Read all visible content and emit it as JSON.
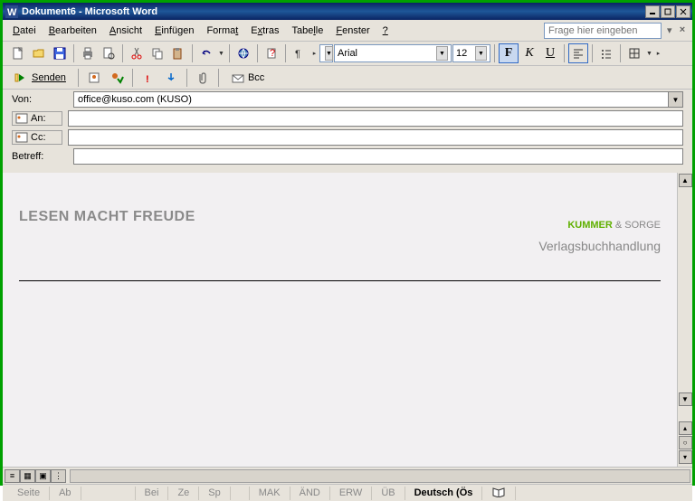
{
  "window": {
    "title": "Dokument6 - Microsoft Word"
  },
  "menu": {
    "items": [
      "Datei",
      "Bearbeiten",
      "Ansicht",
      "Einfügen",
      "Format",
      "Extras",
      "Tabelle",
      "Fenster",
      "?"
    ],
    "helpPlaceholder": "Frage hier eingeben"
  },
  "formatting": {
    "fontName": "Arial",
    "fontSize": "12",
    "bold": "F",
    "italic": "K",
    "underline": "U"
  },
  "email": {
    "sendLabel": "Senden",
    "bccLabel": "Bcc",
    "fields": {
      "von": {
        "label": "Von:",
        "value": "office@kuso.com   (KUSO)"
      },
      "an": {
        "label": "An:",
        "value": ""
      },
      "cc": {
        "label": "Cc:",
        "value": ""
      },
      "betreff": {
        "label": "Betreff:",
        "value": ""
      }
    }
  },
  "document": {
    "slogan": "LESEN MACHT FREUDE",
    "companyName1": "KUMMER",
    "companyAmp": " & ",
    "companyName2": "SORGE",
    "companySub": "Verlagsbuchhandlung"
  },
  "status": {
    "seite": "Seite",
    "ab": "Ab",
    "bei": "Bei",
    "ze": "Ze",
    "sp": "Sp",
    "mak": "MAK",
    "and": "ÄND",
    "erw": "ERW",
    "ub": "ÜB",
    "lang": "Deutsch (Ös"
  }
}
